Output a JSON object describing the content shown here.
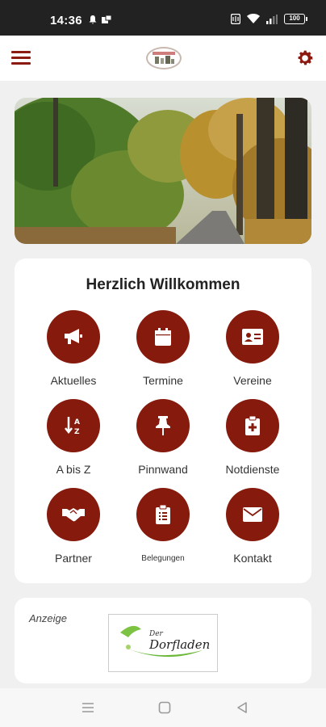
{
  "status_bar": {
    "time": "14:36",
    "battery": "100"
  },
  "header": {
    "menu_icon": "hamburger-menu-icon",
    "settings_icon": "gear-icon",
    "logo_icon": "community-logo"
  },
  "welcome": {
    "title": "Herzlich Willkommen",
    "tiles": [
      {
        "label": "Aktuelles",
        "icon": "megaphone-icon"
      },
      {
        "label": "Termine",
        "icon": "calendar-icon"
      },
      {
        "label": "Vereine",
        "icon": "id-card-icon"
      },
      {
        "label": "A bis Z",
        "icon": "sort-alpha-icon"
      },
      {
        "label": "Pinnwand",
        "icon": "pushpin-icon"
      },
      {
        "label": "Notdienste",
        "icon": "medical-clipboard-icon"
      },
      {
        "label": "Partner",
        "icon": "handshake-icon"
      },
      {
        "label": "Belegungen",
        "icon": "clipboard-list-icon"
      },
      {
        "label": "Kontakt",
        "icon": "envelope-icon"
      }
    ]
  },
  "ad": {
    "label": "Anzeige",
    "logo_text": "Der Dorfladen"
  },
  "colors": {
    "brand": "#861a0d",
    "background": "#f0f0f0"
  }
}
